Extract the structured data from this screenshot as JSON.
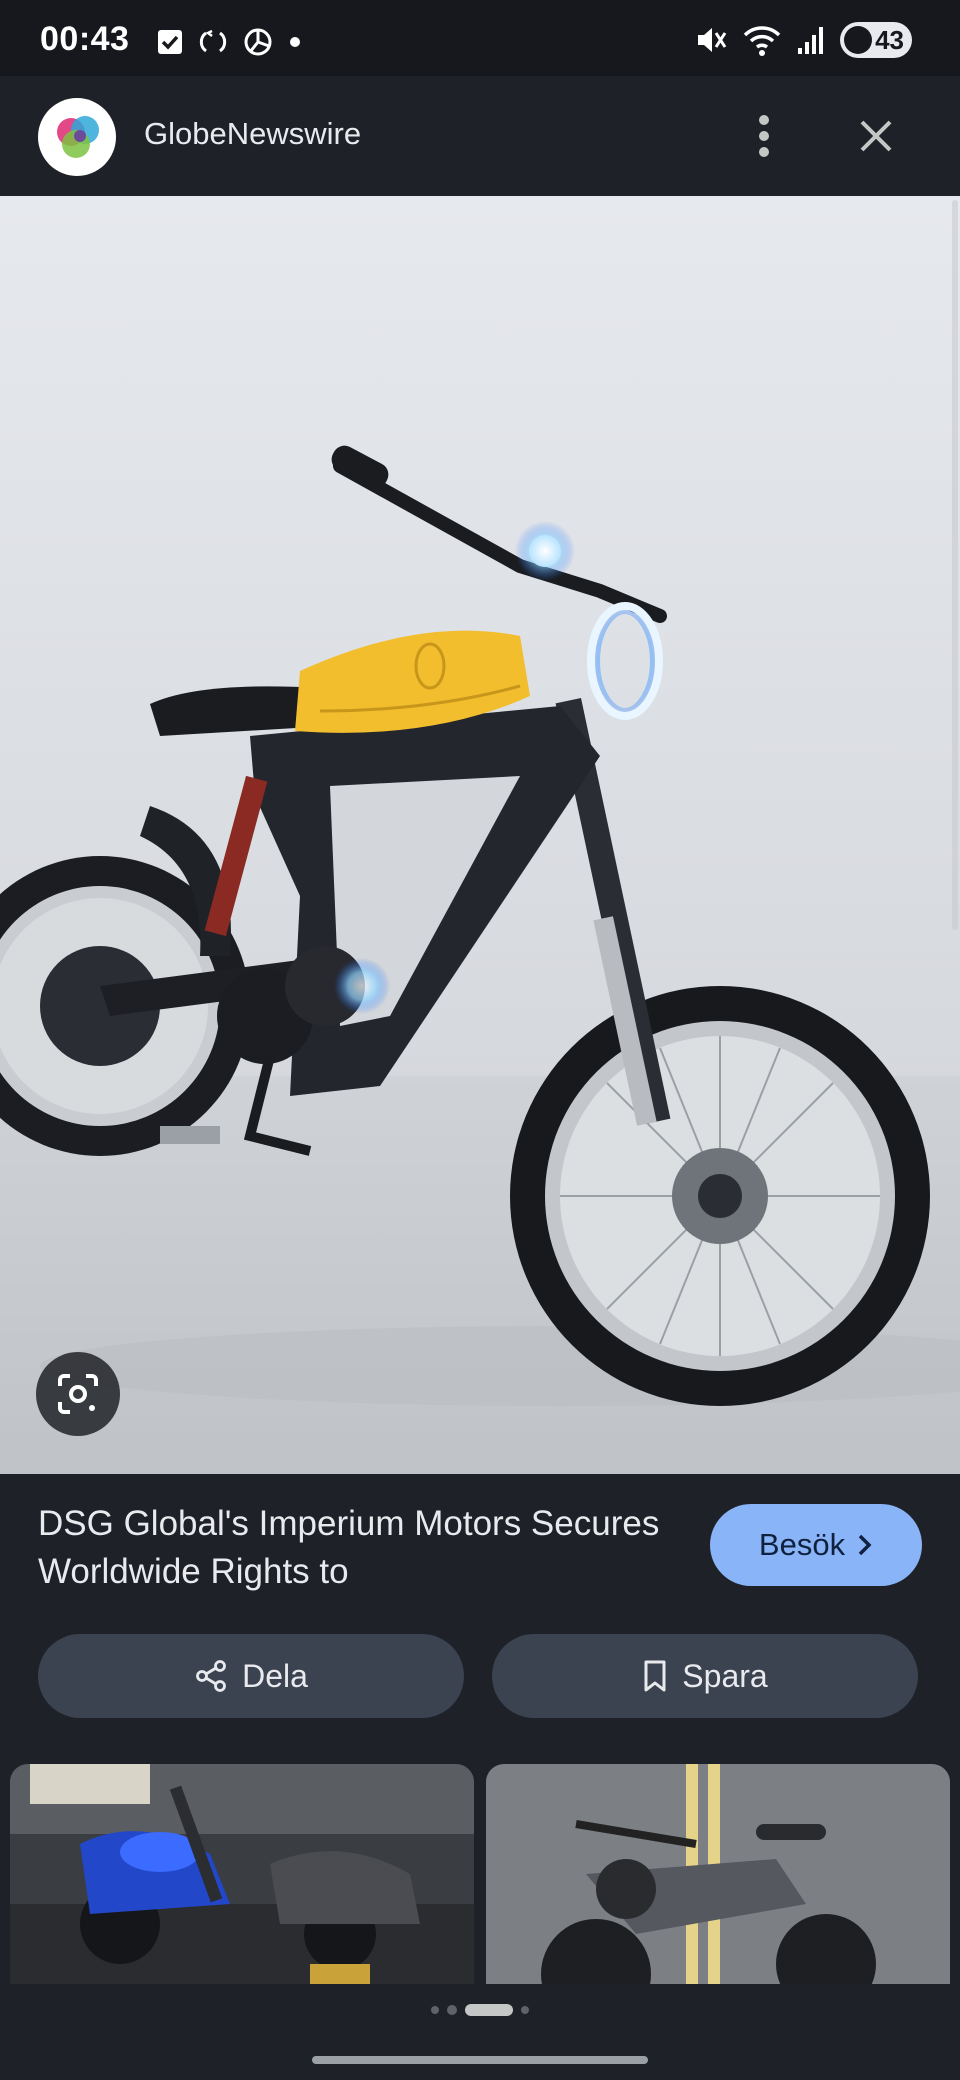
{
  "status_bar": {
    "time": "00:43",
    "battery_level": "43",
    "left_icons": [
      "checkbox-icon",
      "sync-icon",
      "chart-icon",
      "dot-icon"
    ],
    "right_icons": [
      "mute-icon",
      "wifi-icon",
      "signal-icon",
      "battery-icon"
    ]
  },
  "header": {
    "site_name": "GlobeNewswire",
    "menu_icon": "more-vert-icon",
    "close_icon": "close-icon"
  },
  "main_image": {
    "description_icon": "lens-icon"
  },
  "article": {
    "title": "DSG Global's Imperium Motors Secures Worldwide Rights to",
    "visit_label": "Besök",
    "share_label": "Dela",
    "save_label": "Spara"
  },
  "pager": {
    "count": 4,
    "active_index": 2
  },
  "colors": {
    "background": "#1f2128",
    "accent": "#8ab4f8",
    "chip": "#3b4350",
    "tank_yellow": "#f2be2e"
  }
}
